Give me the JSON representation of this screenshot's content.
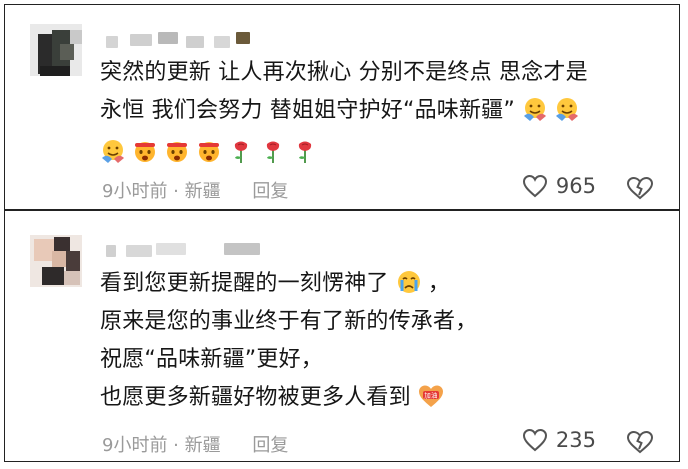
{
  "comments": [
    {
      "lines": [
        "突然的更新 让人再次揪心 分别不是终点 思念才是",
        "永恒 我们会努力 替姐姐守护好“品味新疆”"
      ],
      "time": "9小时前",
      "location": "新疆",
      "reply_label": "回复",
      "like_count": "965"
    },
    {
      "lines": [
        "看到您更新提醒的一刻愣神了",
        "原来是您的事业终于有了新的传承者，",
        "祝愿“品味新疆”更好，",
        "也愿更多新疆好物被更多人看到"
      ],
      "time": "9小时前",
      "location": "新疆",
      "reply_label": "回复",
      "like_count": "235"
    }
  ],
  "emoji_badge_text": "加油",
  "icons": [
    "heart-outline-icon",
    "broken-heart-icon",
    "hug-emoji",
    "cheer-emoji",
    "rose-emoji",
    "crying-emoji",
    "jiayou-heart-emoji"
  ],
  "colors": {
    "meta_gray": "#9a9a9a",
    "rose_red": "#e0373f",
    "emoji_yellow": "#ffc83d"
  }
}
